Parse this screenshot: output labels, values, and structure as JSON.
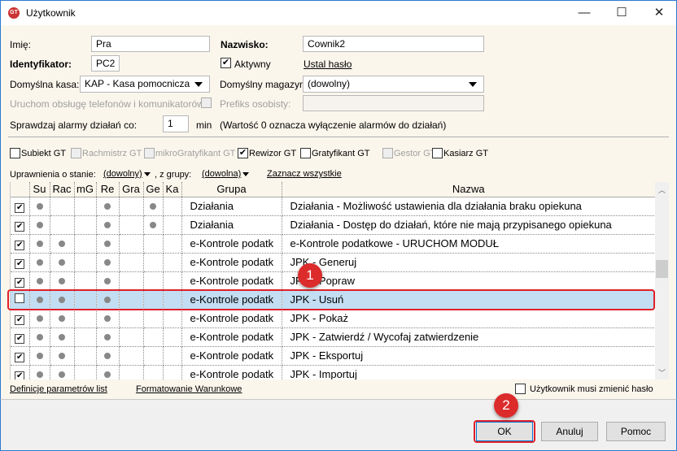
{
  "window": {
    "title": "Użytkownik",
    "minimize": "—",
    "maximize": "☐",
    "close": "✕",
    "icon_text": "GT"
  },
  "form": {
    "imie_label": "Imię:",
    "imie_value": "Pra",
    "nazwisko_label": "Nazwisko:",
    "nazwisko_value": "Cownik2",
    "identyfikator_label": "Identyfikator:",
    "identyfikator_value": "PC2",
    "aktywny_label": "Aktywny",
    "aktywny_checked": true,
    "ustal_haslo": "Ustal hasło",
    "kasa_label": "Domyślna kasa:",
    "kasa_value": "KAP - Kasa pomocnicza",
    "magazyn_label": "Domyślny magazyn:",
    "magazyn_value": "(dowolny)",
    "telefony_label": "Uruchom obsługę telefonów i komunikatorów",
    "prefiks_label": "Prefiks osobisty:",
    "prefiks_value": "",
    "alarmy_label": "Sprawdzaj alarmy działań co:",
    "alarmy_value": "1",
    "alarmy_unit": "min",
    "alarmy_note": "(Wartość 0 oznacza wyłączenie alarmów do działań)"
  },
  "apps": [
    {
      "label": "Subiekt GT",
      "checked": false,
      "disabled": false
    },
    {
      "label": "Rachmistrz GT",
      "checked": false,
      "disabled": true
    },
    {
      "label": "mikroGratyfikant GT",
      "checked": false,
      "disabled": true
    },
    {
      "label": "Rewizor GT",
      "checked": true,
      "disabled": false
    },
    {
      "label": "Gratyfikant GT",
      "checked": false,
      "disabled": false
    },
    {
      "label": "Gestor GT",
      "checked": false,
      "disabled": true
    },
    {
      "label": "Kasiarz GT",
      "checked": false,
      "disabled": false
    }
  ],
  "filter": {
    "stan_label": "Uprawnienia o stanie:",
    "stan_value": "(dowolny)",
    "grupa_label": ", z grupy:",
    "grupa_value": "(dowolna)",
    "zaznacz": "Zaznacz wszystkie"
  },
  "grid": {
    "columns": [
      "",
      "Su",
      "Rac",
      "mG",
      "Re",
      "Gra",
      "Ge",
      "Ka",
      "Grupa",
      "Nazwa"
    ],
    "rows": [
      {
        "checked": true,
        "dots": [
          1,
          0,
          0,
          1,
          0,
          1,
          0
        ],
        "grupa": "Działania",
        "nazwa": "Działania - Możliwość ustawienia dla działania braku opiekuna"
      },
      {
        "checked": true,
        "dots": [
          1,
          0,
          0,
          1,
          0,
          1,
          0
        ],
        "grupa": "Działania",
        "nazwa": "Działania - Dostęp do działań, które nie mają przypisanego opiekuna"
      },
      {
        "checked": true,
        "dots": [
          1,
          1,
          0,
          1,
          0,
          0,
          0
        ],
        "grupa": "e-Kontrole podatk",
        "nazwa": "e-Kontrole podatkowe - URUCHOM MODUŁ"
      },
      {
        "checked": true,
        "dots": [
          1,
          1,
          0,
          1,
          0,
          0,
          0
        ],
        "grupa": "e-Kontrole podatk",
        "nazwa": "JPK - Generuj"
      },
      {
        "checked": true,
        "dots": [
          1,
          1,
          0,
          1,
          0,
          0,
          0
        ],
        "grupa": "e-Kontrole podatk",
        "nazwa": "JPK - Popraw"
      },
      {
        "checked": false,
        "selected": true,
        "dots": [
          1,
          1,
          0,
          1,
          0,
          0,
          0
        ],
        "grupa": "e-Kontrole podatk",
        "nazwa": "JPK - Usuń"
      },
      {
        "checked": true,
        "dots": [
          1,
          1,
          0,
          1,
          0,
          0,
          0
        ],
        "grupa": "e-Kontrole podatk",
        "nazwa": "JPK - Pokaż"
      },
      {
        "checked": true,
        "dots": [
          1,
          1,
          0,
          1,
          0,
          0,
          0
        ],
        "grupa": "e-Kontrole podatk",
        "nazwa": "JPK - Zatwierdź / Wycofaj zatwierdzenie"
      },
      {
        "checked": true,
        "dots": [
          1,
          1,
          0,
          1,
          0,
          0,
          0
        ],
        "grupa": "e-Kontrole podatk",
        "nazwa": "JPK - Eksportuj"
      },
      {
        "checked": true,
        "dots": [
          1,
          1,
          0,
          1,
          0,
          0,
          0
        ],
        "grupa": "e-Kontrole podatk",
        "nazwa": "JPK - Importuj"
      }
    ]
  },
  "links": {
    "definicje": "Definicje parametrów list",
    "formatowanie": "Formatowanie Warunkowe"
  },
  "musi_zmienic": "Użytkownik musi zmienić hasło",
  "buttons": {
    "ok": "OK",
    "anuluj": "Anuluj",
    "pomoc": "Pomoc"
  },
  "annotations": {
    "badge1": "1",
    "badge2": "2"
  }
}
